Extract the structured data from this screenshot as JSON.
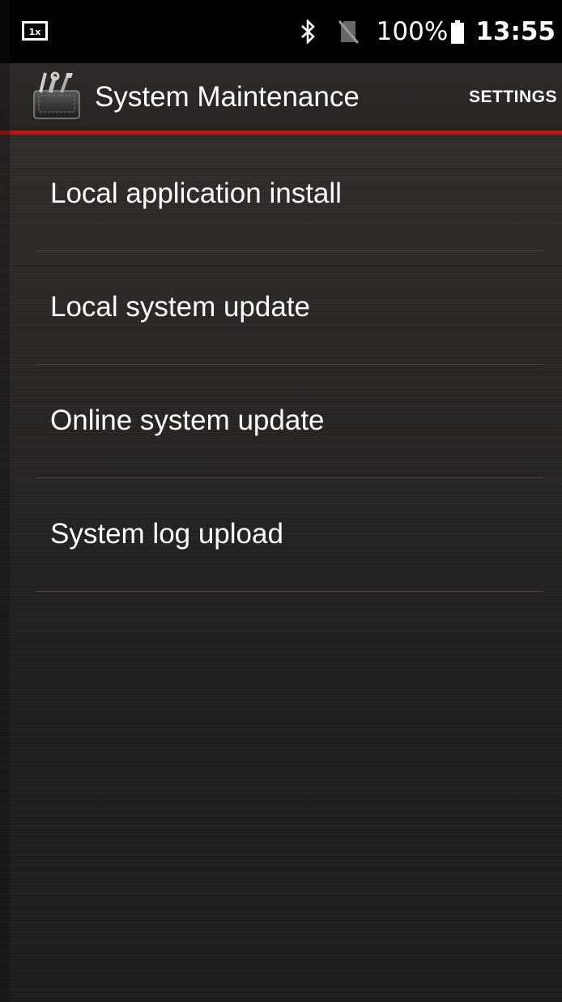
{
  "status_bar": {
    "left_icon": "screenshot-notification-icon",
    "bluetooth_icon": "bluetooth-icon",
    "no_sim_icon": "no-sim-icon",
    "battery_percent": "100%",
    "battery_icon": "battery-full-icon",
    "time": "13:55"
  },
  "action_bar": {
    "logo_icon": "toolbox-icon",
    "title": "System Maintenance",
    "settings_label": "SETTINGS",
    "accent_color": "#c01515"
  },
  "menu": {
    "items": [
      {
        "label": "Local application install"
      },
      {
        "label": "Local system update"
      },
      {
        "label": "Online system update"
      },
      {
        "label": "System log upload"
      }
    ]
  }
}
